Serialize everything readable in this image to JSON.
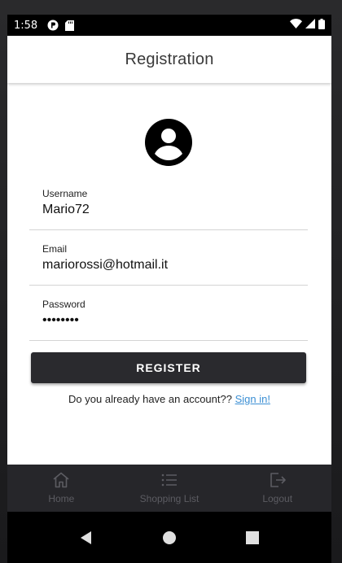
{
  "status_bar": {
    "time": "1:58"
  },
  "app_bar": {
    "title": "Registration"
  },
  "form": {
    "username": {
      "label": "Username",
      "value": "Mario72"
    },
    "email": {
      "label": "Email",
      "value": "mariorossi@hotmail.it"
    },
    "password": {
      "label": "Password",
      "value": "••••••••"
    },
    "register_label": "REGISTER",
    "signin_prompt": "Do you already have an account?? ",
    "signin_link": "Sign in!"
  },
  "bottom_nav": {
    "items": [
      {
        "label": "Home",
        "icon": "home-icon"
      },
      {
        "label": "Shopping List",
        "icon": "list-icon"
      },
      {
        "label": "Logout",
        "icon": "logout-icon"
      }
    ]
  },
  "colors": {
    "accent": "#3b8fd4",
    "button": "#2a2a2e",
    "nav_bg": "#26262a"
  }
}
